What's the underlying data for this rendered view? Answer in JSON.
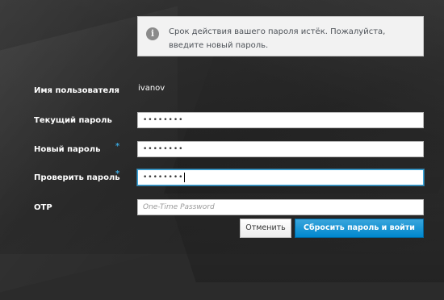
{
  "alert": {
    "icon": "info-icon",
    "message": "Срок действия вашего пароля истёк. Пожалуйста, введите новый пароль."
  },
  "form": {
    "username_label": "Имя пользователя",
    "username_value": "ivanov",
    "current_password_label": "Текущий пароль",
    "current_password_value": "••••••••",
    "new_password_label": "Новый пароль",
    "new_password_value": "••••••••",
    "confirm_password_label": "Проверить пароль",
    "confirm_password_value": "••••••••",
    "otp_label": "OTP",
    "otp_placeholder": "One-Time Password",
    "required_marker": "*"
  },
  "buttons": {
    "cancel_label": "Отменить",
    "submit_label": "Сбросить пароль и войти"
  },
  "colors": {
    "accent": "#39a5dc",
    "primary_button": "#0088ce",
    "background": "#2b2b2b"
  }
}
